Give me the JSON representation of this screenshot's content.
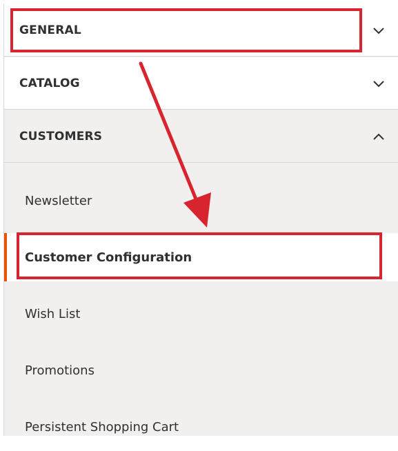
{
  "sections": {
    "general": {
      "label": "GENERAL",
      "state": "collapsed"
    },
    "catalog": {
      "label": "CATALOG",
      "state": "collapsed"
    },
    "customers": {
      "label": "CUSTOMERS",
      "state": "expanded"
    }
  },
  "customers_items": [
    {
      "label": "Newsletter"
    },
    {
      "label": "Customer Configuration",
      "active": true
    },
    {
      "label": "Wish List"
    },
    {
      "label": "Promotions"
    },
    {
      "label": "Persistent Shopping Cart"
    }
  ],
  "colors": {
    "annotation_red": "#d8242f",
    "active_accent": "#eb5202"
  }
}
